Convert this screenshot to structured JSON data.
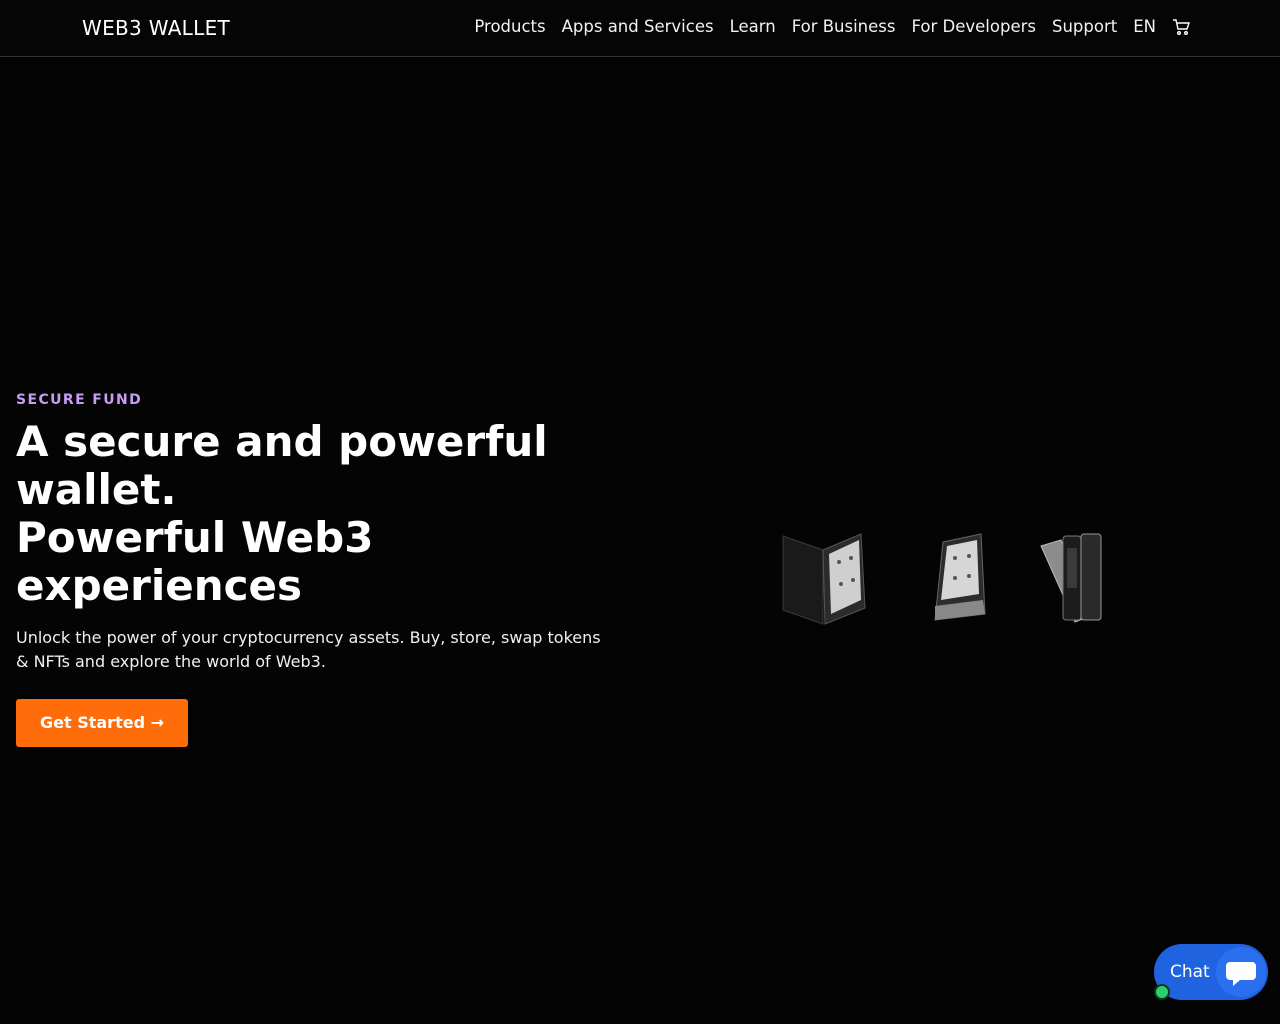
{
  "header": {
    "brand": "WEB3 WALLET",
    "nav": [
      "Products",
      "Apps and Services",
      "Learn",
      "For Business",
      "For Developers",
      "Support",
      "EN"
    ],
    "cart_icon": "cart-icon"
  },
  "hero": {
    "eyebrow": "SECURE FUND",
    "headline_line1": "A secure and powerful wallet.",
    "headline_line2": "Powerful Web3 experiences",
    "subtitle": "Unlock the power of your cryptocurrency assets. Buy, store, swap tokens & NFTs and explore the world of Web3.",
    "cta_label": "Get Started →"
  },
  "chat": {
    "label": "Chat",
    "icon": "chat-bubble-icon"
  },
  "colors": {
    "background": "#040404",
    "accent": "#ff6c0a",
    "eyebrow": "#c79cf5",
    "chat": "#1f63e0"
  }
}
